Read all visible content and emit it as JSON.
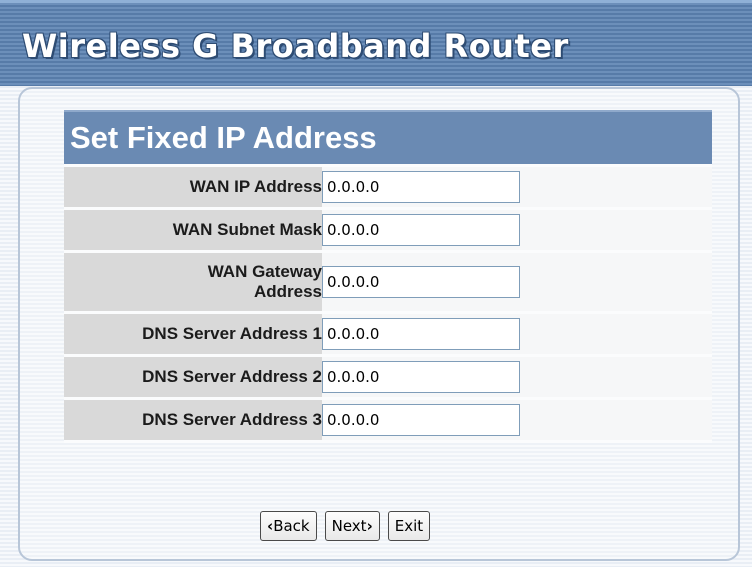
{
  "app": {
    "title": "Wireless G Broadband Router"
  },
  "section": {
    "title": "Set Fixed IP Address"
  },
  "fields": [
    {
      "label": "WAN IP Address",
      "value": "0.0.0.0"
    },
    {
      "label": "WAN Subnet Mask",
      "value": "0.0.0.0"
    },
    {
      "label_line1": "WAN Gateway",
      "label_line2": "Address",
      "value": "0.0.0.0"
    },
    {
      "label": "DNS Server Address 1",
      "value": "0.0.0.0"
    },
    {
      "label": "DNS Server Address 2",
      "value": "0.0.0.0"
    },
    {
      "label": "DNS Server Address 3",
      "value": "0.0.0.0"
    }
  ],
  "buttons": {
    "back": "Back",
    "next": "Next",
    "exit": "Exit"
  },
  "icons": {
    "back": "chevron-left-icon",
    "next": "chevron-right-icon"
  },
  "colors": {
    "header": "#6c8fba",
    "section_head": "#6a8ab3",
    "label_bg": "#d9d9d9"
  }
}
